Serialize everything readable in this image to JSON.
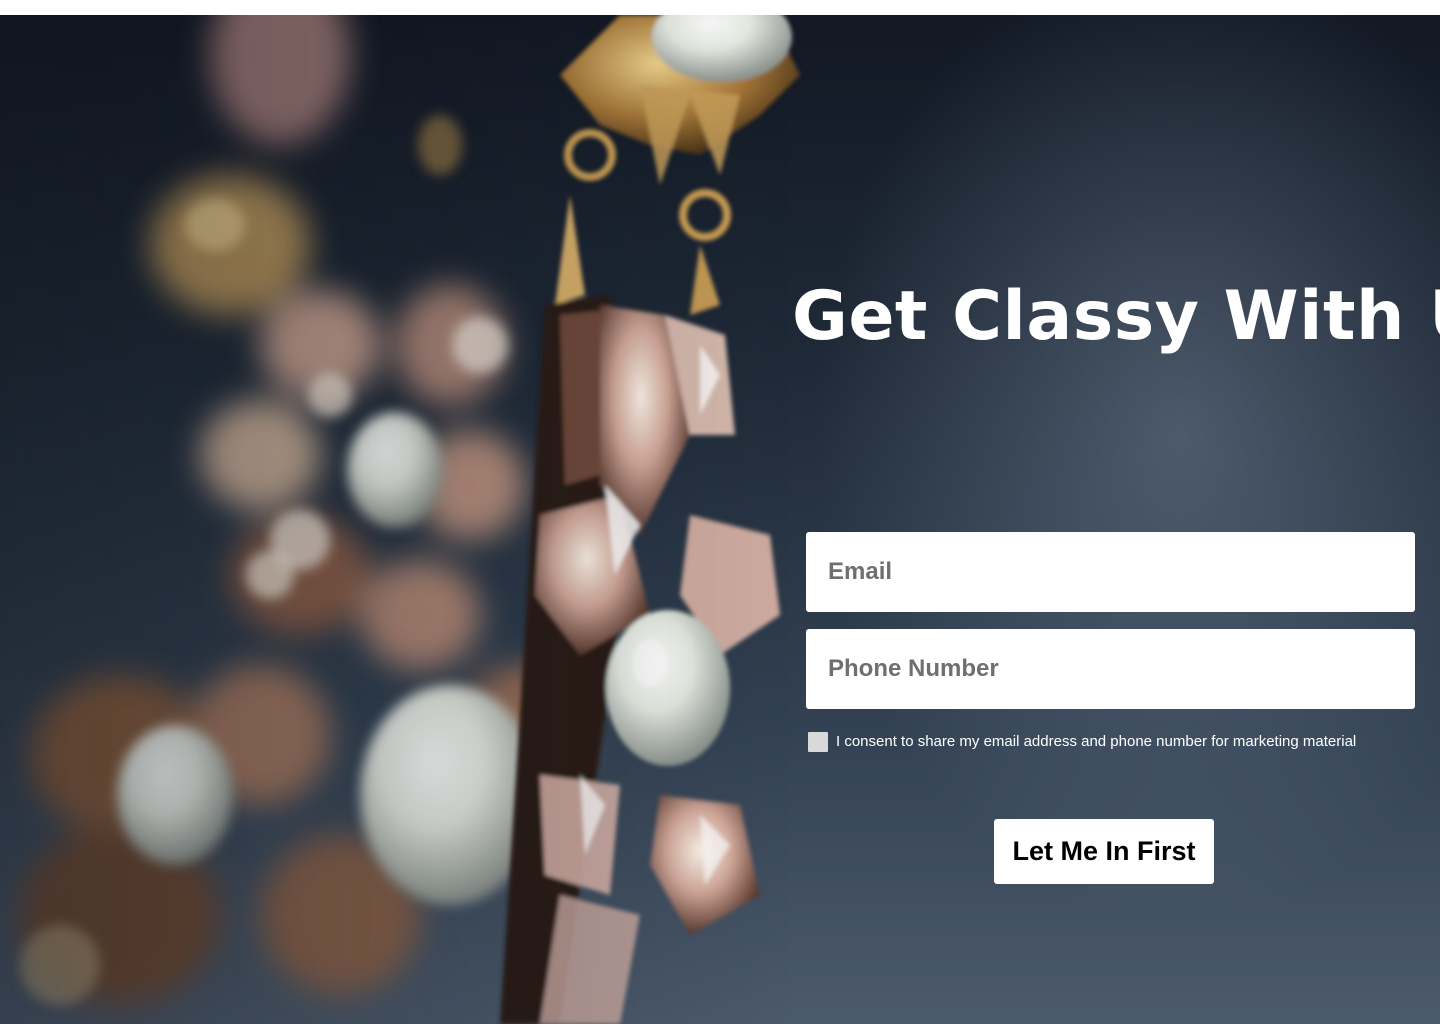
{
  "hero": {
    "headline": "Get Classy With Us",
    "image_subject": "jewelry-pearls-crystals-photo"
  },
  "form": {
    "email_placeholder": "Email",
    "email_value": "",
    "phone_placeholder": "Phone Number",
    "phone_value": "",
    "consent_label": "I consent to share my email address and phone number for marketing material",
    "consent_checked": false,
    "submit_label": "Let Me In First"
  },
  "colors": {
    "background_dark": "#1f2a38",
    "text_light": "#ffffff",
    "checkbox": "#d9d9d9"
  }
}
